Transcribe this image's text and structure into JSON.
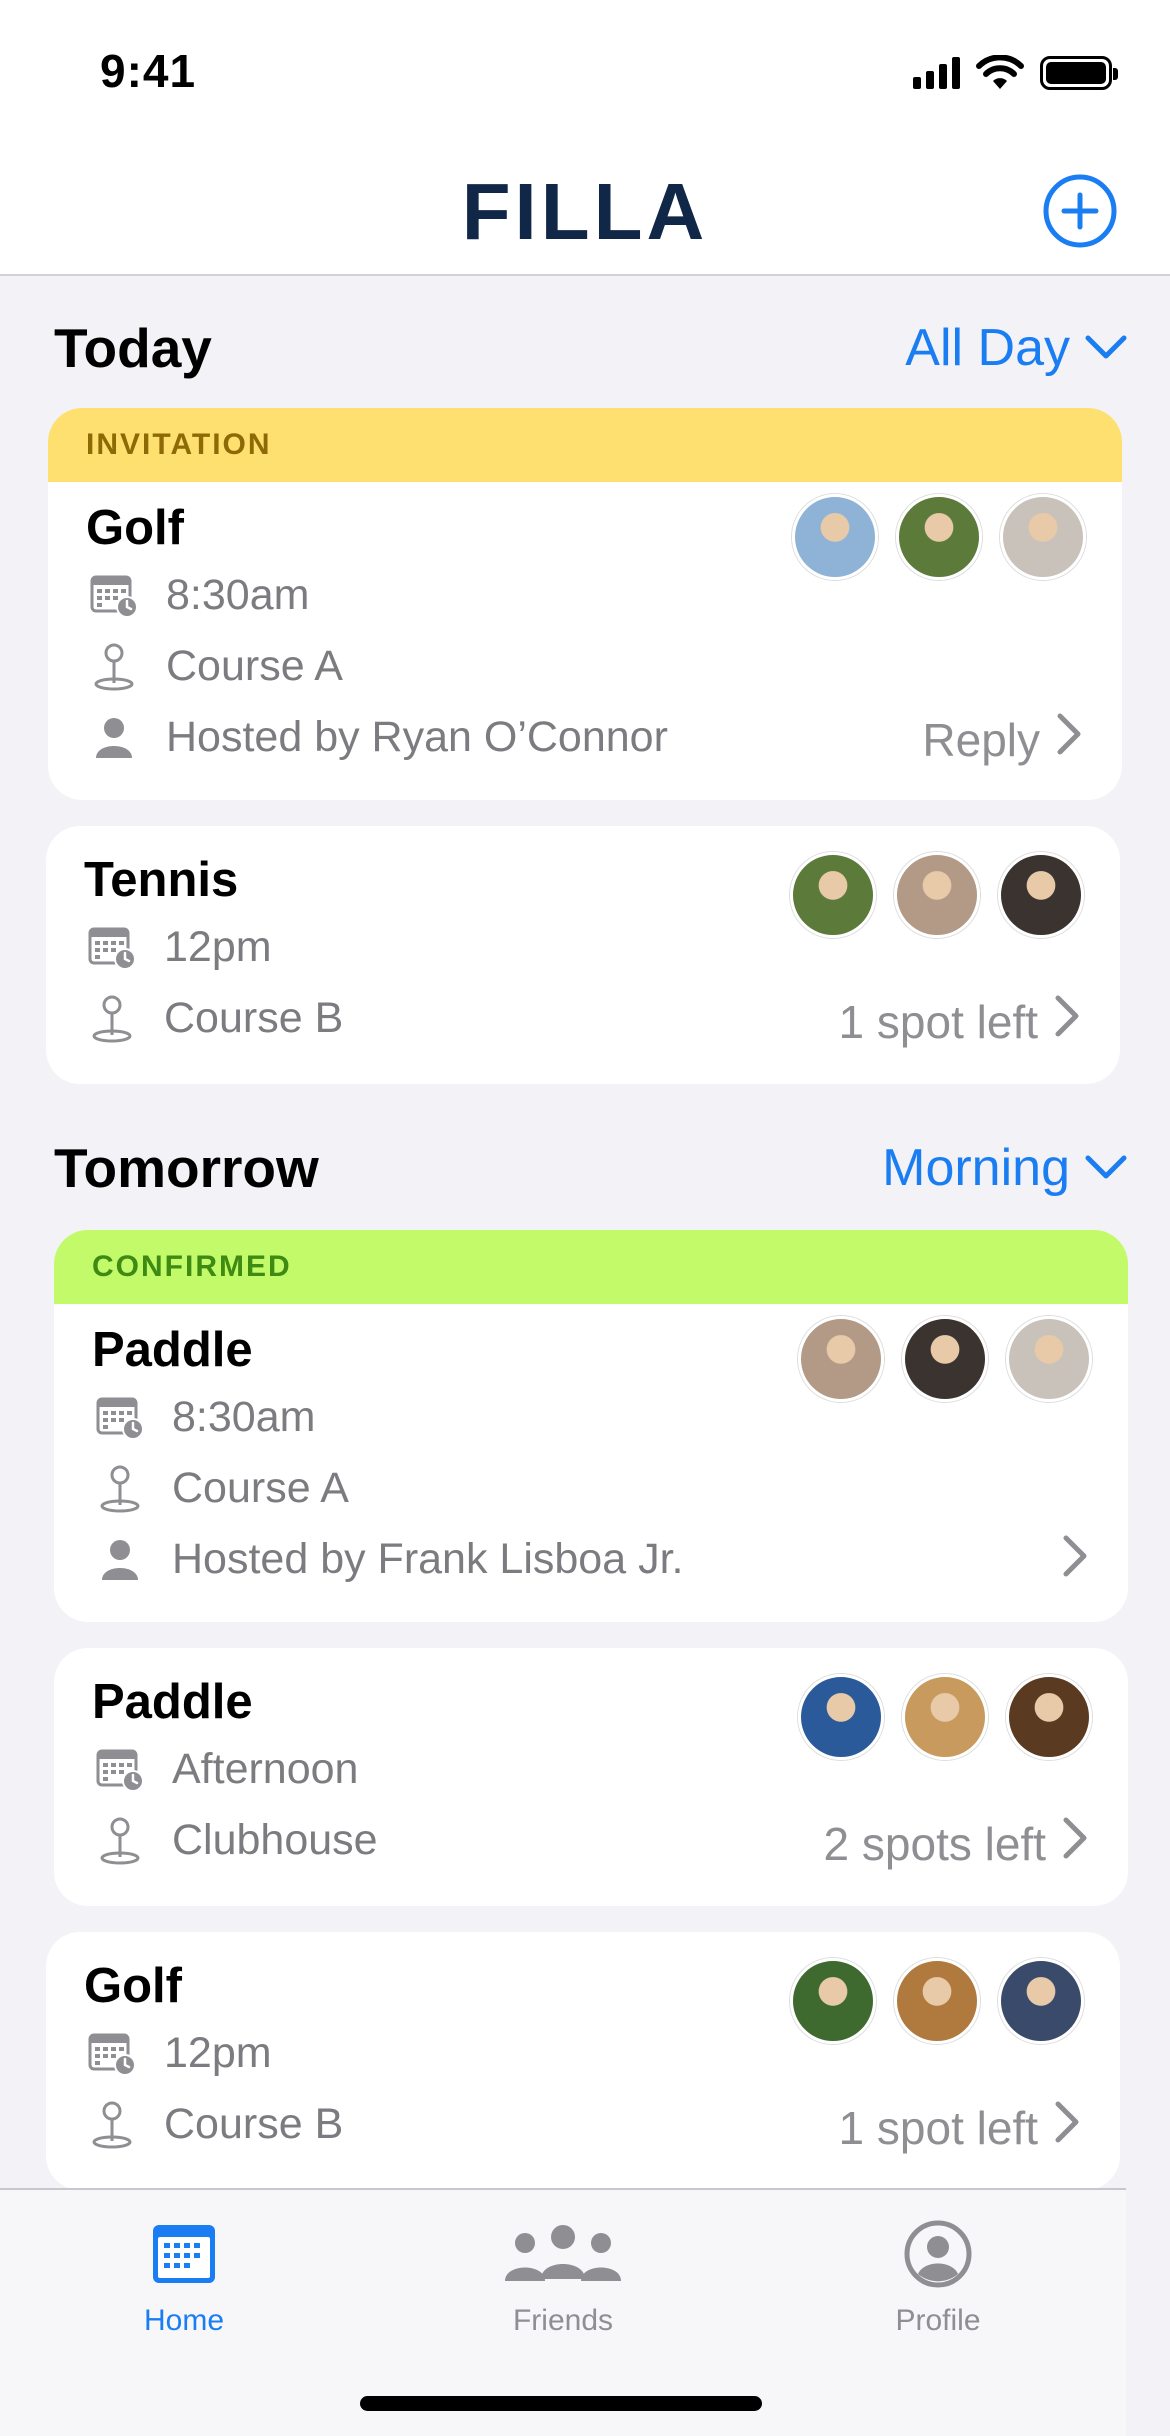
{
  "status": {
    "time": "9:41"
  },
  "header": {
    "brand": "FILLA"
  },
  "sections": [
    {
      "title": "Today",
      "filter": "All Day",
      "cards": [
        {
          "banner": "INVITATION",
          "title": "Golf",
          "time": "8:30am",
          "location": "Course A",
          "host": "Hosted by Ryan O’Connor",
          "action": "Reply",
          "avatars": [
            "#8fb3d6",
            "#5c7a3a",
            "#c9c2bb"
          ]
        },
        {
          "title": "Tennis",
          "time": "12pm",
          "location": "Course B",
          "action": "1 spot left",
          "avatars": [
            "#5c7a3a",
            "#b39a86",
            "#3a3330"
          ]
        }
      ]
    },
    {
      "title": "Tomorrow",
      "filter": "Morning",
      "cards": [
        {
          "banner": "CONFIRMED",
          "title": "Paddle",
          "time": "8:30am",
          "location": "Course A",
          "host": "Hosted by Frank Lisboa Jr.",
          "action": "",
          "avatars": [
            "#b39a86",
            "#3a3330",
            "#c9c2bb"
          ]
        },
        {
          "title": "Paddle",
          "time": "Afternoon",
          "location": "Clubhouse",
          "action": "2 spots left",
          "avatars": [
            "#2b5a9a",
            "#c89a5e",
            "#5a3a20"
          ]
        },
        {
          "title": "Golf",
          "time": "12pm",
          "location": "Course B",
          "action": "1 spot left",
          "avatars": [
            "#3f6a2f",
            "#b07a3e",
            "#3a4a6a"
          ]
        }
      ]
    }
  ],
  "tabs": [
    {
      "label": "Home",
      "icon": "calendar-icon",
      "active": true
    },
    {
      "label": "Friends",
      "icon": "people-icon",
      "active": false
    },
    {
      "label": "Profile",
      "icon": "person-circle-icon",
      "active": false
    }
  ],
  "colors": {
    "accent": "#1a7ef2",
    "brand": "#102748",
    "invitation": "#fde070",
    "confirmed": "#c2fa6a"
  }
}
